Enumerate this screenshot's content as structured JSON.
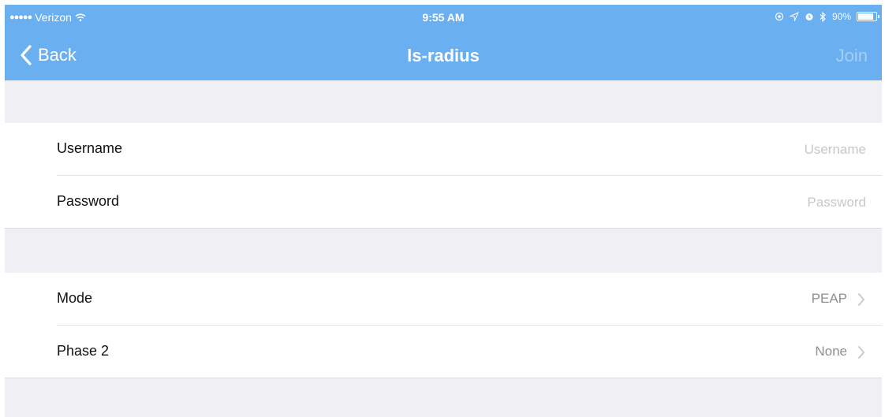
{
  "status_bar": {
    "signal_dots": "●●●●●",
    "carrier": "Verizon",
    "time": "9:55 AM",
    "battery": "90%"
  },
  "nav": {
    "back_label": "Back",
    "title": "ls-radius",
    "join_label": "Join"
  },
  "credentials": {
    "username_label": "Username",
    "username_placeholder": "Username",
    "password_label": "Password",
    "password_placeholder": "Password"
  },
  "settings": {
    "mode_label": "Mode",
    "mode_value": "PEAP",
    "phase2_label": "Phase 2",
    "phase2_value": "None"
  },
  "colors": {
    "accent": "#6ab0f0",
    "background": "#efeff4"
  },
  "icons": [
    "wifi-icon",
    "location-icon",
    "alarm-icon",
    "bluetooth-icon",
    "battery-icon",
    "chevron-left-icon",
    "chevron-right-icon"
  ]
}
